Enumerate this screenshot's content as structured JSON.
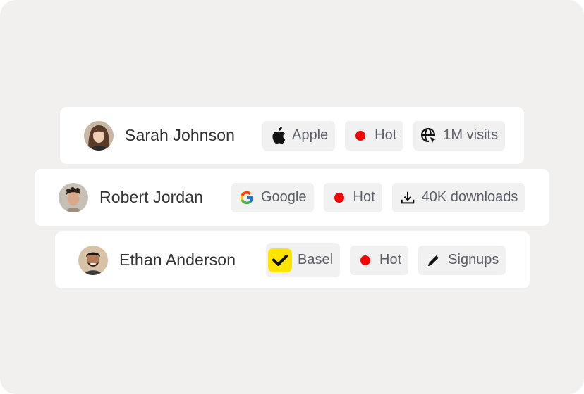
{
  "rows": [
    {
      "name": "Sarah Johnson",
      "avatar": "avatar-woman-brown-hair",
      "company": {
        "label": "Apple",
        "icon": "apple-icon"
      },
      "status": {
        "label": "Hot",
        "color": "#f70000"
      },
      "metric": {
        "label": "1M visits",
        "icon": "globe-cursor-icon"
      }
    },
    {
      "name": "Robert Jordan",
      "avatar": "avatar-man-curly-hair",
      "company": {
        "label": "Google",
        "icon": "google-icon"
      },
      "status": {
        "label": "Hot",
        "color": "#f70000"
      },
      "metric": {
        "label": "40K downloads",
        "icon": "download-icon"
      }
    },
    {
      "name": "Ethan Anderson",
      "avatar": "avatar-man-beard",
      "company": {
        "label": "Basel",
        "icon": "basel-checkmark-icon",
        "color": "#ffe500"
      },
      "status": {
        "label": "Hot",
        "color": "#f70000"
      },
      "metric": {
        "label": "Signups",
        "icon": "pencil-icon"
      }
    }
  ],
  "colors": {
    "background": "#f1f0ef",
    "card": "#ffffff",
    "chip": "#f1f1f1",
    "hot": "#f70000",
    "name_text": "#333333",
    "chip_text": "#5b6068"
  }
}
